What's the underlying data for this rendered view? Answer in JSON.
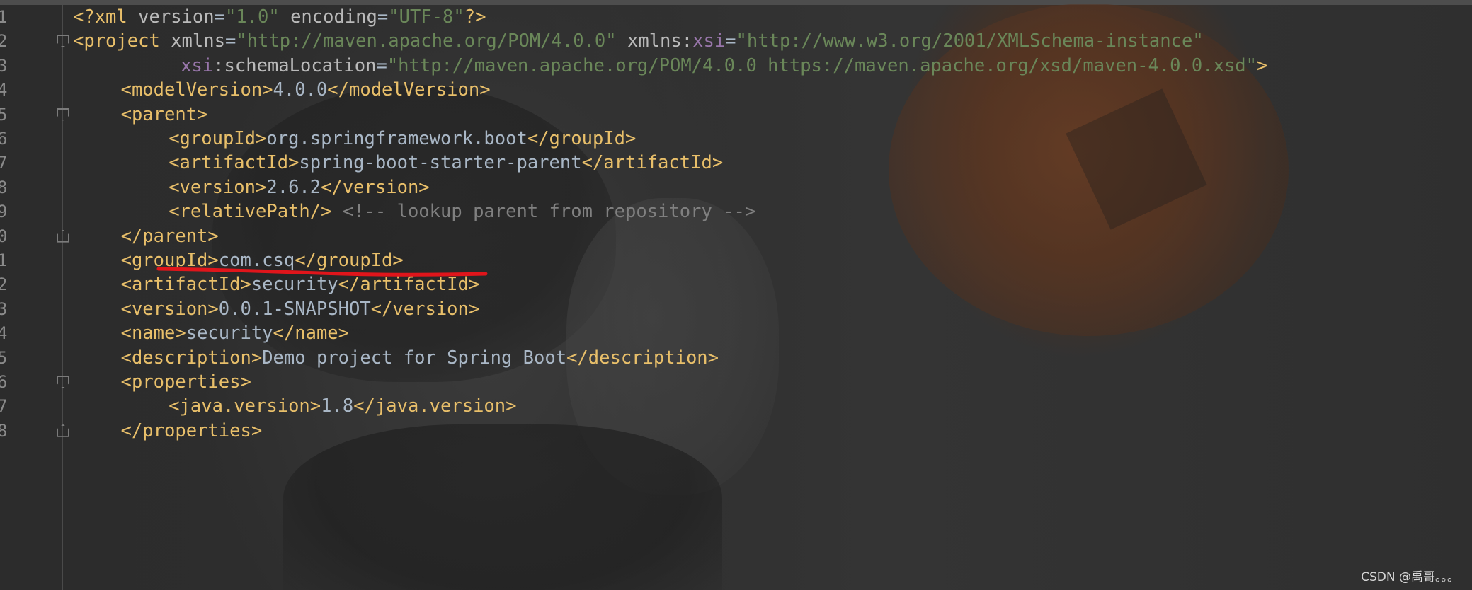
{
  "editor": {
    "lines": [
      {
        "num": "1",
        "fold": "",
        "indent": 0,
        "parts": [
          {
            "cls": "t",
            "text": "<?xml "
          },
          {
            "cls": "a",
            "text": "version"
          },
          {
            "cls": "x",
            "text": "="
          },
          {
            "cls": "v",
            "text": "\"1.0\""
          },
          {
            "cls": "a",
            "text": " encoding"
          },
          {
            "cls": "x",
            "text": "="
          },
          {
            "cls": "v",
            "text": "\"UTF-8\""
          },
          {
            "cls": "t",
            "text": "?>"
          }
        ]
      },
      {
        "num": "2",
        "fold": "open",
        "indent": 0,
        "parts": [
          {
            "cls": "t",
            "text": "<project "
          },
          {
            "cls": "a",
            "text": "xmlns"
          },
          {
            "cls": "x",
            "text": "="
          },
          {
            "cls": "v",
            "text": "\"http://maven.apache.org/POM/4.0.0\""
          },
          {
            "cls": "a",
            "text": " xmlns:"
          },
          {
            "cls": "ns",
            "text": "xsi"
          },
          {
            "cls": "x",
            "text": "="
          },
          {
            "cls": "v",
            "text": "\"http://www.w3.org/2001/XMLSchema-instance\""
          }
        ]
      },
      {
        "num": "3",
        "fold": "",
        "indent": 9,
        "parts": [
          {
            "cls": "ns",
            "text": "xsi"
          },
          {
            "cls": "a",
            "text": ":schemaLocation"
          },
          {
            "cls": "x",
            "text": "="
          },
          {
            "cls": "v",
            "text": "\"http://maven.apache.org/POM/4.0.0 https://maven.apache.org/xsd/maven-4.0.0.xsd\""
          },
          {
            "cls": "t",
            "text": ">"
          }
        ]
      },
      {
        "num": "4",
        "fold": "",
        "indent": 4,
        "parts": [
          {
            "cls": "t",
            "text": "<modelVersion>"
          },
          {
            "cls": "x",
            "text": "4.0.0"
          },
          {
            "cls": "t",
            "text": "</modelVersion>"
          }
        ]
      },
      {
        "num": "5",
        "fold": "open",
        "indent": 4,
        "parts": [
          {
            "cls": "t",
            "text": "<parent>"
          }
        ]
      },
      {
        "num": "6",
        "fold": "",
        "indent": 8,
        "parts": [
          {
            "cls": "t",
            "text": "<groupId>"
          },
          {
            "cls": "x",
            "text": "org.springframework.boot"
          },
          {
            "cls": "t",
            "text": "</groupId>"
          }
        ]
      },
      {
        "num": "7",
        "fold": "",
        "indent": 8,
        "parts": [
          {
            "cls": "t",
            "text": "<artifactId>"
          },
          {
            "cls": "x",
            "text": "spring-boot-starter-parent"
          },
          {
            "cls": "t",
            "text": "</artifactId>"
          }
        ]
      },
      {
        "num": "8",
        "fold": "",
        "indent": 8,
        "parts": [
          {
            "cls": "t",
            "text": "<version>"
          },
          {
            "cls": "x",
            "text": "2.6.2"
          },
          {
            "cls": "t",
            "text": "</version>"
          }
        ]
      },
      {
        "num": "9",
        "fold": "",
        "indent": 8,
        "parts": [
          {
            "cls": "t",
            "text": "<relativePath/>"
          },
          {
            "cls": "c",
            "text": " <!-- lookup parent from repository -->"
          }
        ]
      },
      {
        "num": "0",
        "fold": "close",
        "indent": 4,
        "parts": [
          {
            "cls": "t",
            "text": "</parent>"
          }
        ]
      },
      {
        "num": "1",
        "fold": "",
        "indent": 4,
        "parts": [
          {
            "cls": "t",
            "text": "<groupId>"
          },
          {
            "cls": "x",
            "text": "com.csq"
          },
          {
            "cls": "t",
            "text": "</groupId>"
          }
        ]
      },
      {
        "num": "2",
        "fold": "",
        "indent": 4,
        "parts": [
          {
            "cls": "t",
            "text": "<artifactId>"
          },
          {
            "cls": "x",
            "text": "security"
          },
          {
            "cls": "t",
            "text": "</artifactId>"
          }
        ]
      },
      {
        "num": "3",
        "fold": "",
        "indent": 4,
        "parts": [
          {
            "cls": "t",
            "text": "<version>"
          },
          {
            "cls": "x",
            "text": "0.0.1-SNAPSHOT"
          },
          {
            "cls": "t",
            "text": "</version>"
          }
        ]
      },
      {
        "num": "4",
        "fold": "",
        "indent": 4,
        "parts": [
          {
            "cls": "t",
            "text": "<name>"
          },
          {
            "cls": "x",
            "text": "security"
          },
          {
            "cls": "t",
            "text": "</name>"
          }
        ]
      },
      {
        "num": "5",
        "fold": "",
        "indent": 4,
        "parts": [
          {
            "cls": "t",
            "text": "<description>"
          },
          {
            "cls": "x",
            "text": "Demo project for Spring Boot"
          },
          {
            "cls": "t",
            "text": "</description>"
          }
        ]
      },
      {
        "num": "6",
        "fold": "open",
        "indent": 4,
        "parts": [
          {
            "cls": "t",
            "text": "<properties>"
          }
        ]
      },
      {
        "num": "7",
        "fold": "",
        "indent": 8,
        "parts": [
          {
            "cls": "t",
            "text": "<java.version>"
          },
          {
            "cls": "x",
            "text": "1.8"
          },
          {
            "cls": "t",
            "text": "</java.version>"
          }
        ]
      },
      {
        "num": "8",
        "fold": "close",
        "indent": 4,
        "parts": [
          {
            "cls": "t",
            "text": "</properties>"
          }
        ]
      }
    ]
  },
  "annotation": {
    "color": "#e0151b"
  },
  "watermark": {
    "text": "CSDN @禹哥。。。"
  }
}
